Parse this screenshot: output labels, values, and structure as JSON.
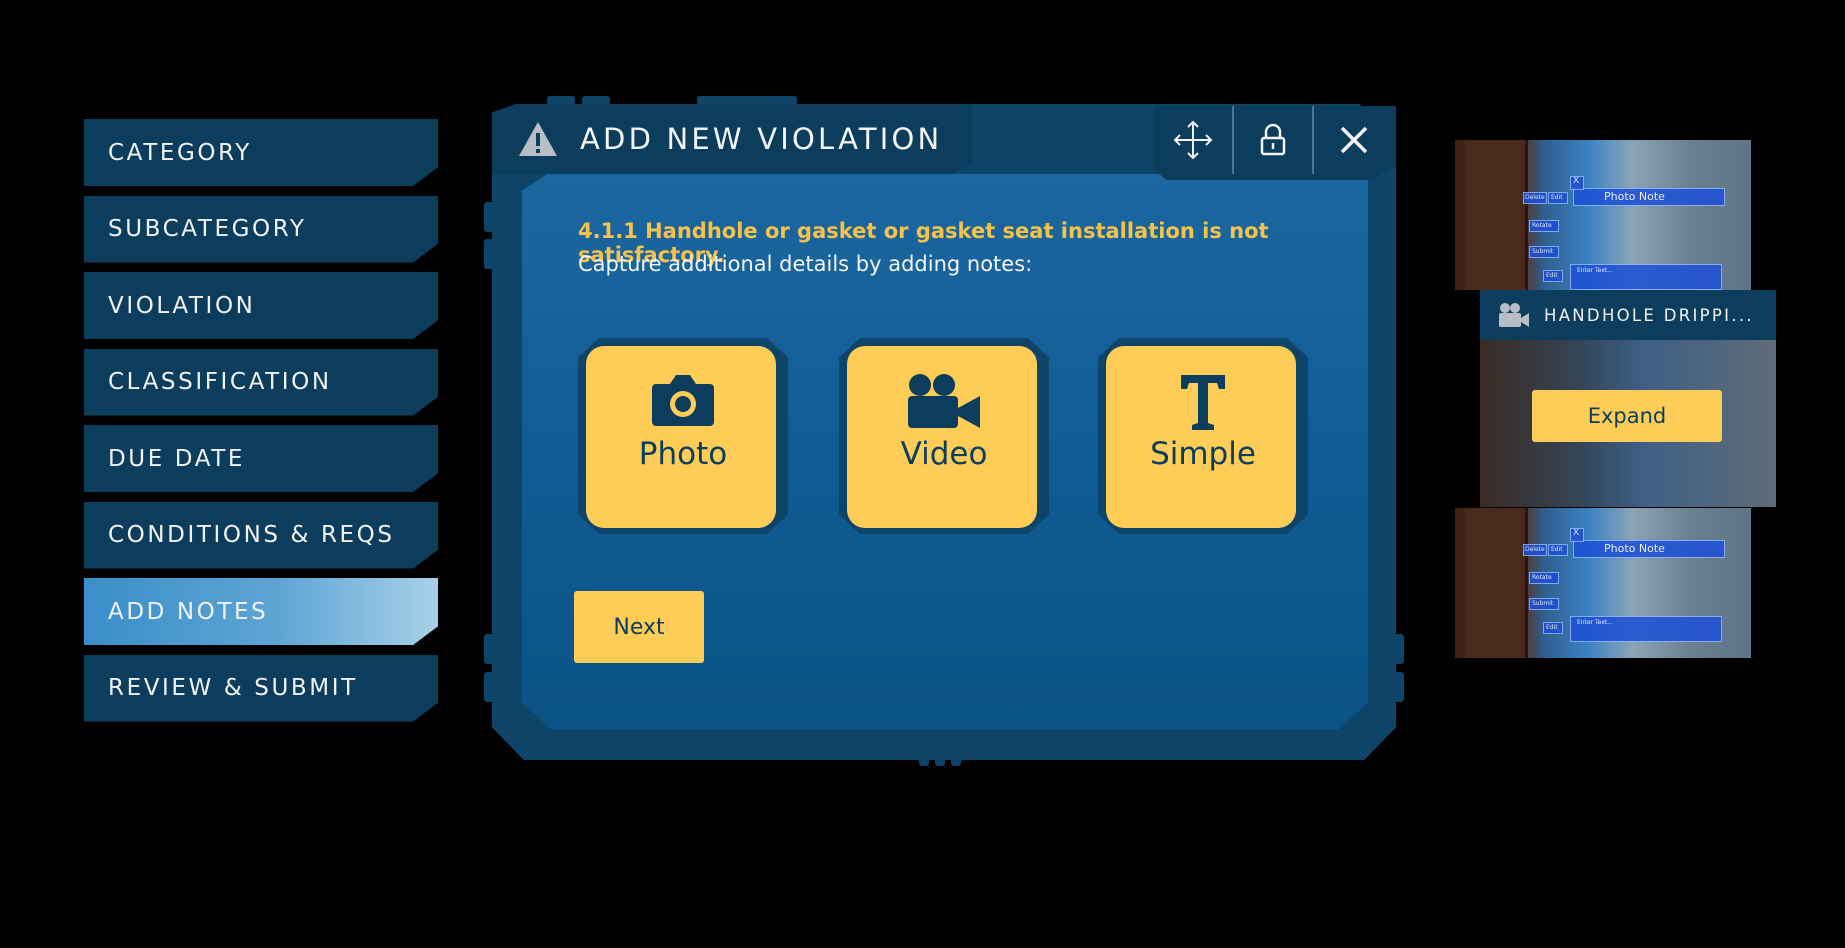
{
  "steps": [
    {
      "label": "CATEGORY",
      "active": false
    },
    {
      "label": "SUBCATEGORY",
      "active": false
    },
    {
      "label": "VIOLATION",
      "active": false
    },
    {
      "label": "CLASSIFICATION",
      "active": false
    },
    {
      "label": "DUE DATE",
      "active": false
    },
    {
      "label": "CONDITIONS & REQS",
      "active": false
    },
    {
      "label": "ADD NOTES",
      "active": true
    },
    {
      "label": "REVIEW & SUBMIT",
      "active": false
    }
  ],
  "dialog": {
    "title": "ADD NEW VIOLATION",
    "title_icon": "warning-icon",
    "controls": [
      "move-icon",
      "lock-icon",
      "close-icon"
    ],
    "violation_text": "4.1.1 Handhole or gasket or gasket seat installation is not satisfactory.",
    "instruction": "Capture additional details by adding notes:",
    "note_types": [
      {
        "label": "Photo",
        "icon": "camera-icon"
      },
      {
        "label": "Video",
        "icon": "video-camera-icon"
      },
      {
        "label": "Simple",
        "icon": "text-icon"
      }
    ],
    "next_label": "Next"
  },
  "preview": {
    "thumb_note_label": "Photo Note",
    "thumb_small_labels": [
      "X",
      "Delete",
      "Edit",
      "Rotate",
      "Submit",
      "Enter Text...",
      "Edit",
      "Edit"
    ],
    "card_title": "HANDHOLE DRIPPI...",
    "card_icon": "video-camera-icon",
    "expand_label": "Expand"
  },
  "colors": {
    "accent_yellow": "#fecd58",
    "heading_yellow": "#f6c24a",
    "panel_dark": "#0d3d5c",
    "panel_mid": "#0d4468",
    "active_step": "#5ea5d4"
  }
}
